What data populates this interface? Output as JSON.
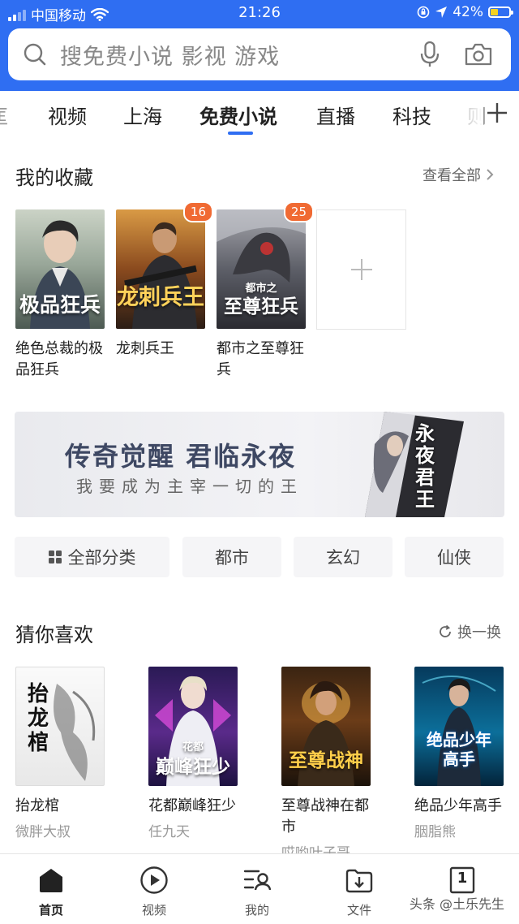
{
  "status_bar": {
    "carrier": "中国移动",
    "time": "21:26",
    "battery_pct": "42%",
    "battery_level": 0.42
  },
  "search": {
    "placeholder": "搜免费小说 影视 游戏"
  },
  "tabs": [
    {
      "label": "视频"
    },
    {
      "label": "上海"
    },
    {
      "label": "免费小说",
      "active": true
    },
    {
      "label": "直播"
    },
    {
      "label": "科技"
    }
  ],
  "favorites": {
    "title": "我的收藏",
    "view_all": "查看全部",
    "books": [
      {
        "title": "绝色总裁的极品狂兵",
        "cover_text": "极品狂兵",
        "badge": ""
      },
      {
        "title": "龙刺兵王",
        "cover_text": "龙刺兵王",
        "badge": "16"
      },
      {
        "title": "都市之至尊狂兵",
        "cover_text": "至尊狂兵",
        "cover_small": "都市之",
        "badge": "25"
      }
    ]
  },
  "banner": {
    "title": "传奇觉醒  君临永夜",
    "subtitle": "我要成为主宰一切的王",
    "art_text": "永夜君王"
  },
  "categories": [
    {
      "label": "全部分类"
    },
    {
      "label": "都市"
    },
    {
      "label": "玄幻"
    },
    {
      "label": "仙侠"
    }
  ],
  "recommend": {
    "title": "猜你喜欢",
    "refresh": "换一换",
    "books": [
      {
        "title": "抬龙棺",
        "author": "微胖大叔",
        "cover_text": "抬龙棺"
      },
      {
        "title": "花都巅峰狂少",
        "author": "任九天",
        "cover_text": "巅峰狂少",
        "cover_small": "花都"
      },
      {
        "title": "至尊战神在都市",
        "author": "哎哟叶子哥",
        "cover_text": "至尊战神"
      },
      {
        "title": "绝品少年高手",
        "author": "胭脂熊",
        "cover_text": "绝品少年高手"
      }
    ]
  },
  "bottom_nav": [
    {
      "label": "首页",
      "icon": "home-icon",
      "active": true
    },
    {
      "label": "视频",
      "icon": "play-circle-icon"
    },
    {
      "label": "我的",
      "icon": "profile-icon"
    },
    {
      "label": "文件",
      "icon": "download-folder-icon"
    },
    {
      "label": "1",
      "icon": "tab-count-icon"
    }
  ],
  "watermark": "头条 @土乐先生",
  "colors": {
    "brand_blue": "#2f6ef2",
    "badge_orange": "#f06a33"
  }
}
